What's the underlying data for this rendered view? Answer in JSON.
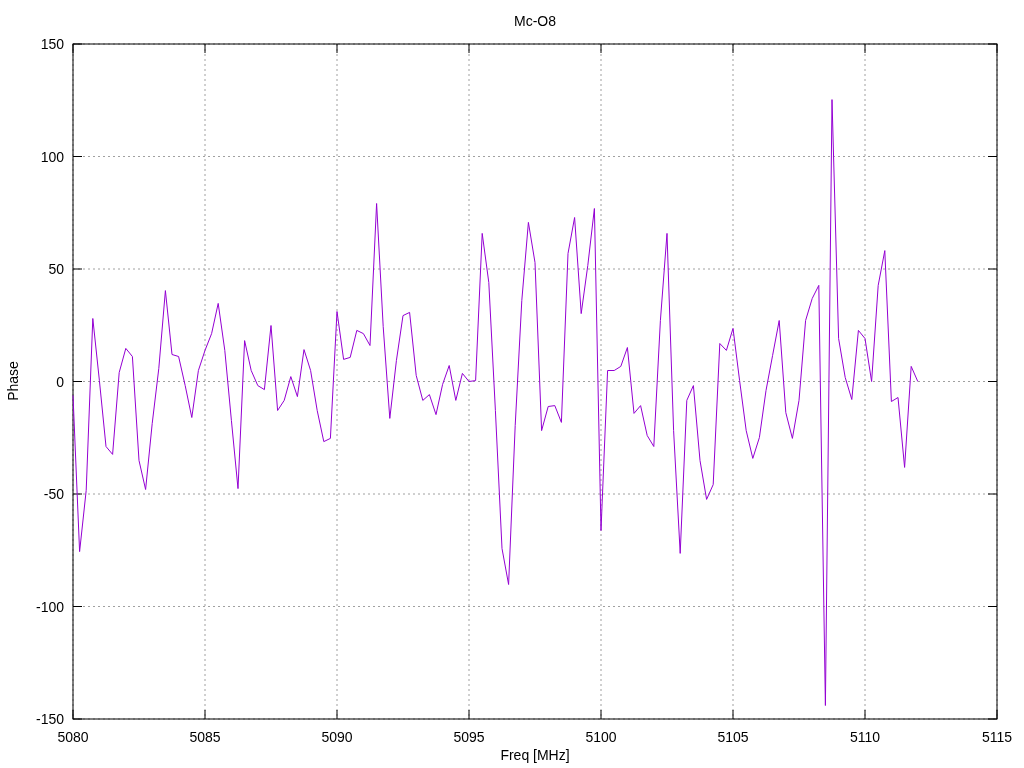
{
  "chart_data": {
    "type": "line",
    "grid": true,
    "title": "Mc-O8",
    "xlabel": "Freq [MHz]",
    "ylabel": "Phase",
    "xlim": [
      5080,
      5115
    ],
    "ylim": [
      -150,
      150
    ],
    "xticks": [
      5080,
      5085,
      5090,
      5095,
      5100,
      5105,
      5110,
      5115
    ],
    "yticks": [
      -150,
      -100,
      -50,
      0,
      50,
      100,
      150
    ],
    "x": [
      5080,
      5080.25,
      5080.5,
      5080.75,
      5081,
      5081.25,
      5081.5,
      5081.75,
      5082,
      5082.25,
      5082.5,
      5082.75,
      5083,
      5083.25,
      5083.5,
      5083.75,
      5084,
      5084.25,
      5084.5,
      5084.75,
      5085,
      5085.25,
      5085.5,
      5085.75,
      5086,
      5086.25,
      5086.5,
      5086.75,
      5087,
      5087.25,
      5087.5,
      5087.75,
      5088,
      5088.25,
      5088.5,
      5088.75,
      5089,
      5089.25,
      5089.5,
      5089.75,
      5090,
      5090.25,
      5090.5,
      5090.75,
      5091,
      5091.25,
      5091.5,
      5091.75,
      5092,
      5092.25,
      5092.5,
      5092.75,
      5093,
      5093.25,
      5093.5,
      5093.75,
      5094,
      5094.25,
      5094.5,
      5094.75,
      5095,
      5095.25,
      5095.5,
      5095.75,
      5096,
      5096.25,
      5096.5,
      5096.75,
      5097,
      5097.25,
      5097.5,
      5097.75,
      5098,
      5098.25,
      5098.5,
      5098.75,
      5099,
      5099.25,
      5099.5,
      5099.75,
      5100,
      5100.25,
      5100.5,
      5100.75,
      5101,
      5101.25,
      5101.5,
      5101.75,
      5102,
      5102.25,
      5102.5,
      5102.75,
      5103,
      5103.25,
      5103.5,
      5103.75,
      5104,
      5104.25,
      5104.5,
      5104.75,
      5105,
      5105.25,
      5105.5,
      5105.75,
      5106,
      5106.25,
      5106.5,
      5106.75,
      5107,
      5107.25,
      5107.5,
      5107.75,
      5108,
      5108.25,
      5108.5,
      5108.75,
      5109,
      5109.25,
      5109.5,
      5109.75,
      5110,
      5110.25,
      5110.5,
      5110.75,
      5111,
      5111.25,
      5111.5,
      5111.75,
      5112
    ],
    "series": [
      {
        "color": "#9400d3",
        "values": [
          -6.2,
          -75.6,
          -48.4,
          28,
          0.4,
          -28.9,
          -32.4,
          4,
          14.7,
          11.1,
          -35.1,
          -48,
          -18.7,
          5.8,
          40.4,
          12,
          11.1,
          -1.8,
          -16,
          4.9,
          13.8,
          21.3,
          34.7,
          13.8,
          -17.3,
          -47.6,
          18.2,
          4.9,
          -1.8,
          -3.6,
          24.9,
          -12.9,
          -8.4,
          2.2,
          -6.7,
          14.2,
          4.9,
          -12.9,
          -26.7,
          -25.3,
          31.1,
          9.8,
          10.7,
          22.7,
          21.3,
          16,
          79.1,
          24.4,
          -16.4,
          9.3,
          29.3,
          30.7,
          2.7,
          -8.4,
          -5.8,
          -14.7,
          -1.3,
          7.1,
          -8.4,
          3.6,
          0,
          0.4,
          65.8,
          44,
          -12.9,
          -74.2,
          -90.2,
          -19.6,
          36,
          70.7,
          52.9,
          -21.8,
          -11.1,
          -10.7,
          -18.2,
          56.9,
          72.9,
          30.2,
          51.6,
          76.9,
          -66.2,
          4.9,
          4.9,
          6.7,
          15.1,
          -14.2,
          -10.7,
          -24,
          -28.9,
          27.1,
          65.8,
          -21.8,
          -76.4,
          -8.4,
          -1.8,
          -35.1,
          -52.4,
          -45.8,
          16.9,
          13.8,
          23.6,
          0.4,
          -21.8,
          -34.2,
          -24.9,
          -4,
          11.6,
          27.1,
          -13.8,
          -25.3,
          -8.4,
          27.1,
          36.9,
          42.7,
          -144,
          125.3,
          19.1,
          1.8,
          -8,
          22.7,
          19.1,
          0,
          42.7,
          58.2,
          -8.9,
          -7.1,
          -38.2,
          6.7,
          0
        ]
      }
    ]
  }
}
